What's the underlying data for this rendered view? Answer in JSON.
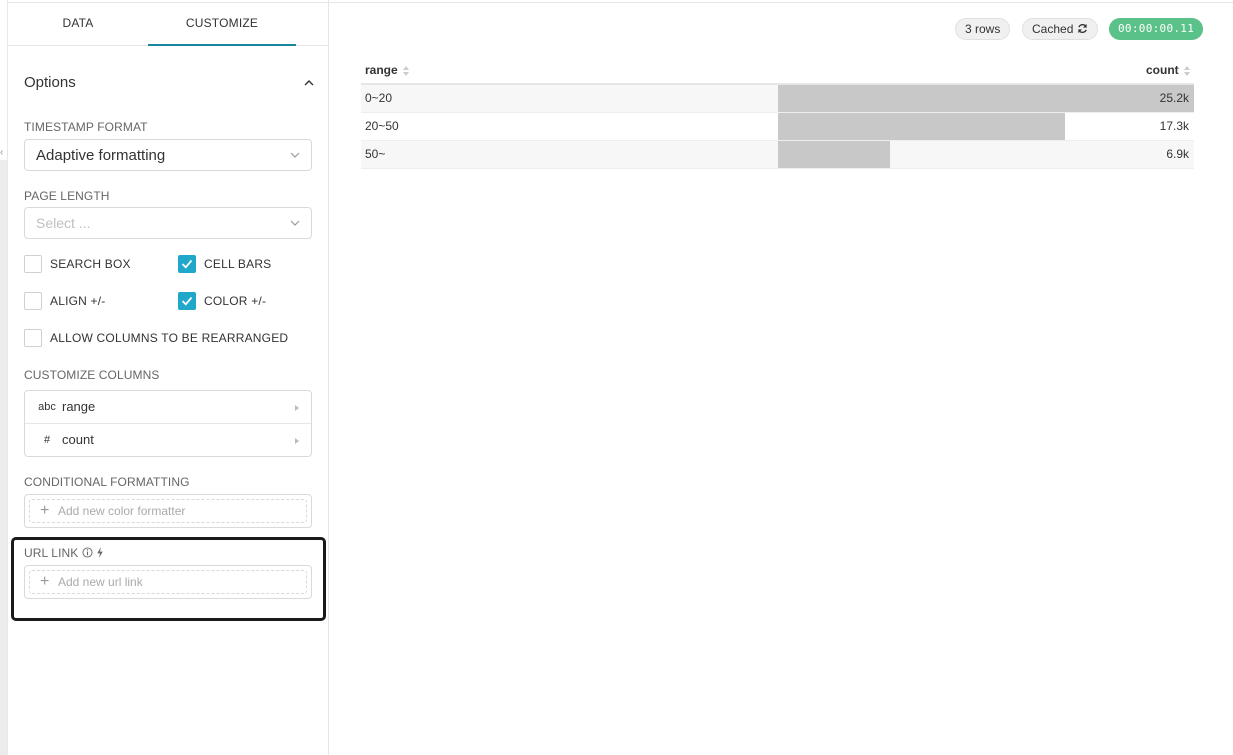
{
  "tabs": {
    "data": "DATA",
    "customize": "CUSTOMIZE"
  },
  "options": {
    "title": "Options",
    "timestamp_format": {
      "label": "TIMESTAMP FORMAT",
      "value": "Adaptive formatting"
    },
    "page_length": {
      "label": "PAGE LENGTH",
      "placeholder": "Select ..."
    },
    "checkboxes": {
      "search_box": {
        "label": "SEARCH BOX",
        "checked": false
      },
      "cell_bars": {
        "label": "CELL BARS",
        "checked": true
      },
      "align": {
        "label": "ALIGN +/-",
        "checked": false
      },
      "color": {
        "label": "COLOR +/-",
        "checked": true
      },
      "allow_rearrange": {
        "label": "ALLOW COLUMNS TO BE REARRANGED",
        "checked": false
      }
    },
    "customize_columns": {
      "label": "CUSTOMIZE COLUMNS",
      "items": [
        {
          "type": "abc",
          "name": "range"
        },
        {
          "type": "#",
          "name": "count"
        }
      ]
    },
    "conditional_formatting": {
      "label": "CONDITIONAL FORMATTING",
      "add_text": "Add new color formatter"
    },
    "url_link": {
      "label": "URL LINK",
      "add_text": "Add new url link"
    }
  },
  "status": {
    "rows": "3 rows",
    "cached": "Cached",
    "time": "00:00:00.11"
  },
  "table": {
    "columns": [
      "range",
      "count"
    ],
    "rows": [
      {
        "range": "0~20",
        "count": "25.2k",
        "ratio": 1.0
      },
      {
        "range": "20~50",
        "count": "17.3k",
        "ratio": 0.69
      },
      {
        "range": "50~",
        "count": "6.9k",
        "ratio": 0.27
      }
    ]
  },
  "colors": {
    "accent": "#1fa8c9",
    "timer": "#5ac189",
    "bar": "#c8c8c8"
  }
}
